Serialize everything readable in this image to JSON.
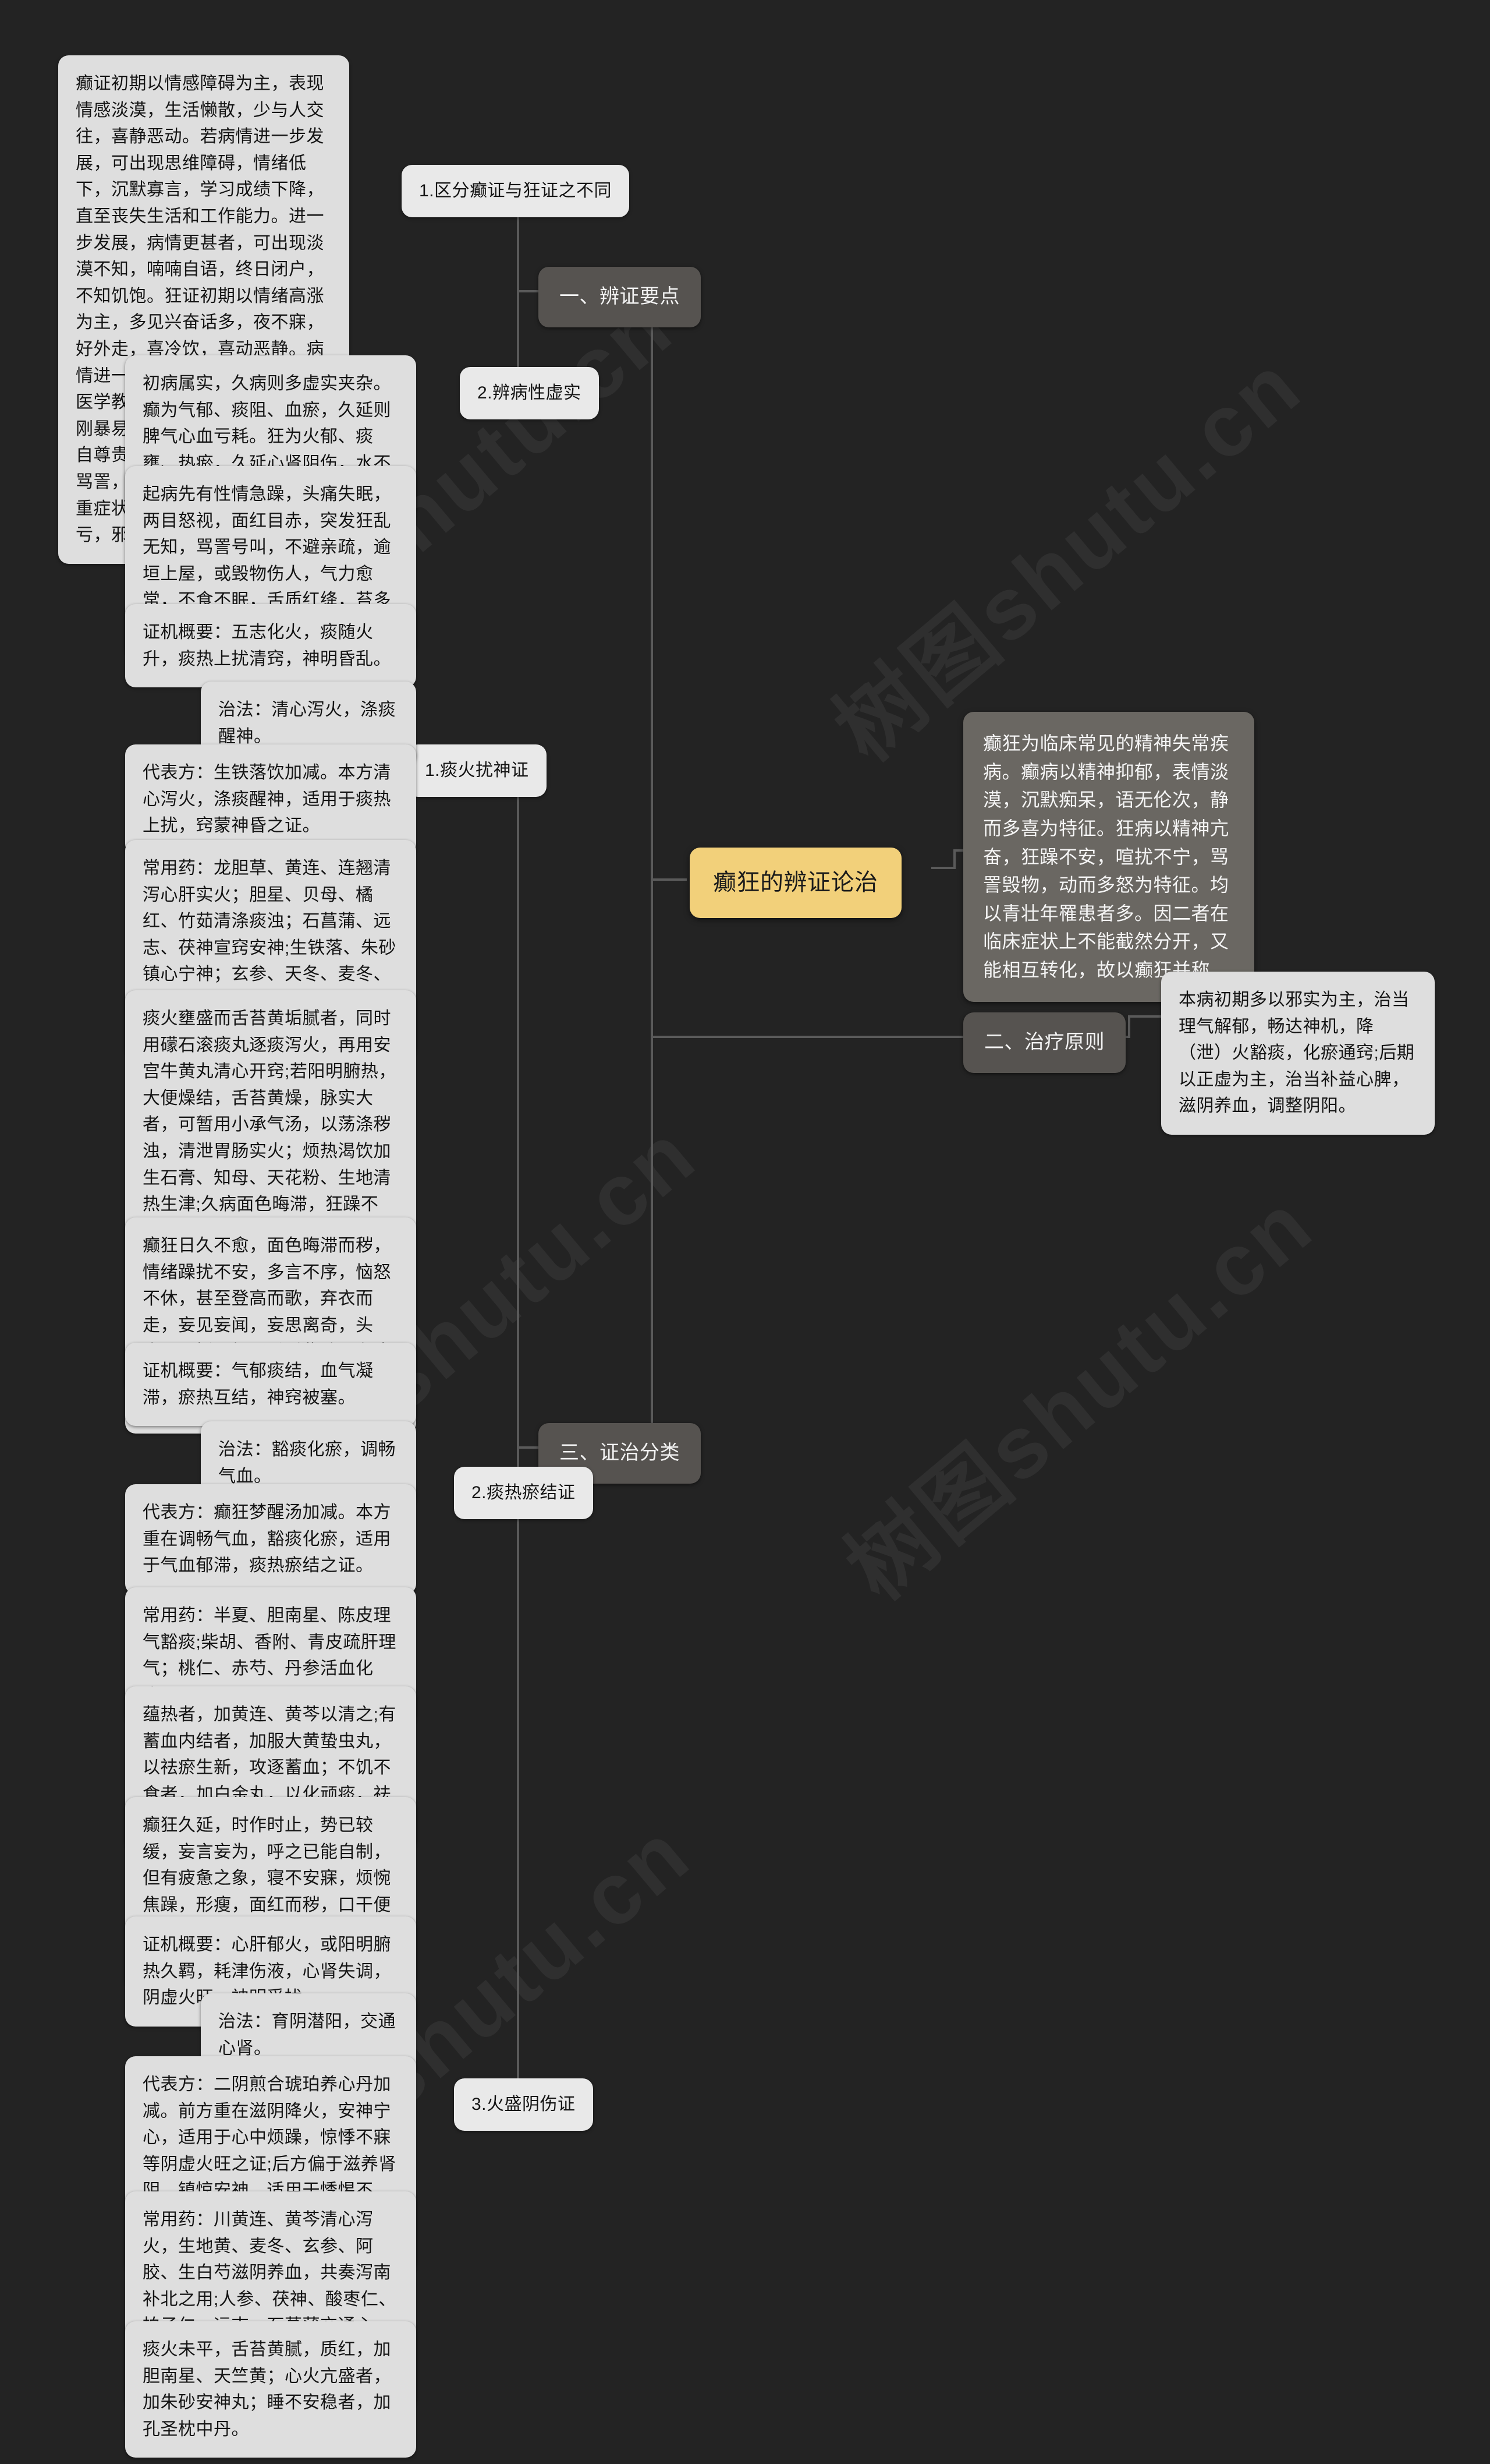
{
  "root": {
    "label": "癫狂的辨证论治"
  },
  "watermarks": [
    "树图shutu.cn",
    "树图shutu.cn",
    "树图shutu.cn",
    "树图shutu.cn",
    "树图shutu.cn"
  ],
  "sections": [
    {
      "id": "s1",
      "label": "一、辨证要点"
    },
    {
      "id": "s2",
      "label": "二、治疗原则"
    },
    {
      "id": "s3",
      "label": "三、证治分类"
    }
  ],
  "branches": [
    {
      "id": "b1",
      "label": "1.区分癫证与狂证之不同"
    },
    {
      "id": "b2",
      "label": "2.辨病性虚实"
    },
    {
      "id": "b3",
      "label": "1.痰火扰神证"
    },
    {
      "id": "b4",
      "label": "2.痰热瘀结证"
    },
    {
      "id": "b5",
      "label": "3.火盛阴伤证"
    }
  ],
  "leaves": {
    "l1": "癫证初期以情感障碍为主，表现情感淡漠，生活懒散，少与人交往，喜静恶动。若病情进一步发展，可出现思维障碍，情绪低下，沉默寡言，学习成绩下降，直至丧失生活和工作能力。进一步发展，病情更甚者，可出现淡漠不知，喃喃自语，终日闭户，不知饥饱。狂证初期以情绪高涨为主，多见兴奋话多，夜不寐，好外走，喜冷饮，喜动恶静。病情进一步发展，渐至频繁外走，医学教|育网搜集整理气力倍增，刚暴易怒，登高而歌，自高贤，自尊贵，部分患者亦可出现呼号骂詈，不避水火，不避亲疏的严重症状。癫狂至晚期，正气大亏，邪气犹存，临床极为难治。",
    "l2": "初病属实，久病则多虚实夹杂。癫为气郁、痰阻、血瘀，久延则脾气心血亏耗。狂为火郁、痰壅、热瘀，久延心肾阴伤，水不济火，而致阴虚火旺。",
    "l3": "起病先有性情急躁，头痛失眠，两目怒视，面红目赤，突发狂乱无知，骂詈号叫，不避亲疏，逾垣上屋，或毁物伤人，气力愈常，不食不眠，舌质红绛，苔多黄腻或黄燥而垢，脉弦大滑数。",
    "l4": "证机概要：五志化火，痰随火升，痰热上扰清窍，神明昏乱。",
    "l5": "治法：清心泻火，涤痰醒神。",
    "l6": "代表方：生铁落饮加减。本方清心泻火，涤痰醒神，适用于痰热上扰，窍蒙神昏之证。",
    "l7": "常用药：龙胆草、黄连、连翘清泻心肝实火；胆星、贝母、橘红、竹茹清涤痰浊；石菖蒲、远志、茯神宣窍安神;生铁落、朱砂镇心宁神；玄参、天冬、麦冬、丹参养心血，固心阴，活瘀血，以防火热伤阴之弊。",
    "l8": "痰火壅盛而舌苔黄垢腻者，同时用礞石滚痰丸逐痰泻火，再用安宫牛黄丸清心开窍;若阳明腑热，大便燥结，舌苔黄燥，脉实大者，可暂用小承气汤，以荡涤秽浊，清泄胃肠实火；烦热渴饮加生石膏、知母、天花粉、生地清热生津;久病面色晦滞，狂躁不安，行为乖异，舌质青紫有瘀斑，脉沉弦者，此为瘀热阻窍，可酌加丹皮、赤芍、大黄、桃仁、水蛭；若神志较清，痰热未尽，心烦不寐者，可用温胆汤合朱砂安神丸主之，以化痰安神。",
    "l9": "癫狂日久不愈，面色晦滞而秽，情绪躁扰不安，多言不序，恼怒不休，甚至登高而歌，弃衣而走，妄见妄闻，妄思离奇，头痛，心悸而烦，舌质紫暗，有瘀斑，少苔或薄黄苔干，脉弦细或细涩。",
    "l10": "证机概要：气郁痰结，血气凝滞，瘀热互结，神窍被塞。",
    "l11": "治法：豁痰化瘀，调畅气血。",
    "l12": "代表方：癫狂梦醒汤加减。本方重在调畅气血，豁痰化瘀，适用于气血郁滞，痰热瘀结之证。",
    "l13": "常用药：半夏、胆南星、陈皮理气豁痰;柴胡、香附、青皮疏肝理气；桃仁、赤芍、丹参活血化瘀。",
    "l14": "蕴热者，加黄连、黄芩以清之;有蓄血内结者，加服大黄蛰虫丸，以祛瘀生新，攻逐蓄血；不饥不食者，加白金丸，以化顽痰，祛恶血。",
    "l15": "癫狂久延，时作时止，势已较缓，妄言妄为，呼之已能自制，但有疲惫之象，寝不安寐，烦惋焦躁，形瘦，面红而秽，口干便难，舌尖红无苔，有剥裂，脉细数。",
    "l16": "证机概要：心肝郁火，或阳明腑热久羁，耗津伤液，心肾失调，阴虚火旺，神明受扰。",
    "l17": "治法：育阴潜阳，交通心肾。",
    "l18": "代表方：二阴煎合琥珀养心丹加减。前方重在滋阴降火，安神宁心，适用于心中烦躁，惊悸不寐等阴虚火旺之证;后方偏于滋养肾阴，镇惊安神，适用于悸惕不安，医学教|育网搜集整理反应迟钝等心肾不足之证。",
    "l19": "常用药：川黄连、黄芩清心泻火，生地黄、麦冬、玄参、阿胶、生白芍滋阴养血，共奏泻南补北之用;人参、茯神、酸枣仁、柏子仁、远志、石菖蒲交通心肾，安神定志；生龙齿、琥珀、朱砂镇心安神。",
    "l20": "痰火未平，舌苔黄腻，质红，加胆南星、天竺黄；心火亢盛者，加朱砂安神丸；睡不安稳者，加孔圣枕中丹。",
    "r1": "癫狂为临床常见的精神失常疾病。癫病以精神抑郁，表情淡漠，沉默痴呆，语无伦次，静而多喜为特征。狂病以精神亢奋，狂躁不安，喧扰不宁，骂詈毁物，动而多怒为特征。均以青壮年罹患者多。因二者在临床症状上不能截然分开，又能相互转化，故以癫狂并称。",
    "r2": "本病初期多以邪实为主，治当理气解郁，畅达神机，降（泄）火豁痰，化瘀通窍;后期以正虚为主，治当补益心脾，滋阴养血，调整阴阳。"
  },
  "colors": {
    "background": "#232323",
    "root_accent": "#f2d07a",
    "section_bg": "#565350",
    "leaf_bg": "#dedede",
    "branch_bg": "#e9e9e9",
    "description_bg": "#6a6762",
    "link_stroke": "#5a5a5a"
  }
}
